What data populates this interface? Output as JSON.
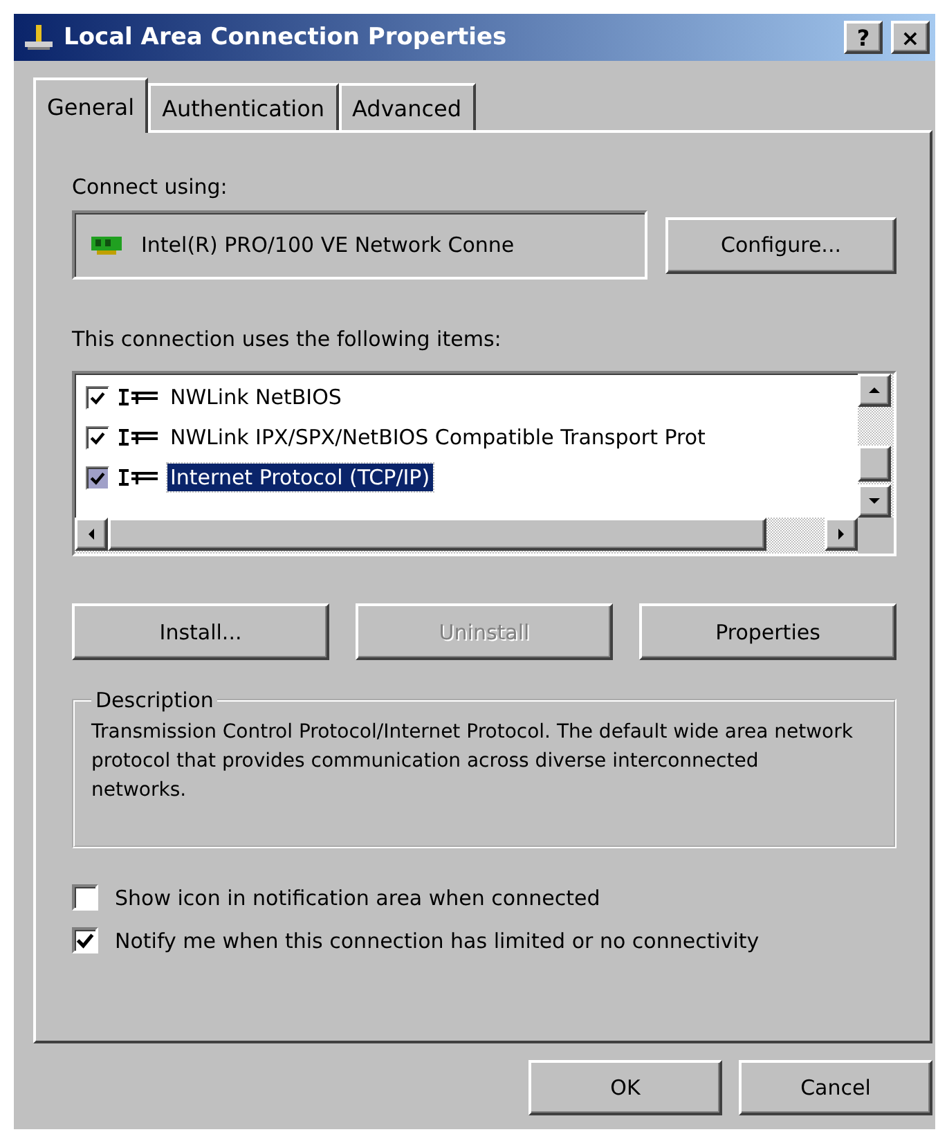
{
  "window": {
    "title": "Local Area Connection Properties",
    "title_buttons": [
      "?",
      "×"
    ]
  },
  "tabs": [
    {
      "label": "General",
      "selected": true
    },
    {
      "label": "Authentication",
      "selected": false
    },
    {
      "label": "Advanced",
      "selected": false
    }
  ],
  "connect_using": {
    "label": "Connect using:",
    "adapter": "Intel(R) PRO/100 VE Network Conne",
    "button": "Configure..."
  },
  "items_label": "This connection uses the following items:",
  "items": [
    {
      "label": "NWLink NetBIOS",
      "checked": true,
      "selected": false
    },
    {
      "label": "NWLink IPX/SPX/NetBIOS Compatible Transport Prot",
      "checked": true,
      "selected": false
    },
    {
      "label": "Internet Protocol (TCP/IP)",
      "checked": true,
      "selected": true
    }
  ],
  "item_buttons": [
    {
      "label": "Install...",
      "disabled": false
    },
    {
      "label": "Uninstall",
      "disabled": true
    },
    {
      "label": "Properties",
      "disabled": false
    }
  ],
  "description": {
    "title": "Description",
    "text": "Transmission Control Protocol/Internet Protocol. The default wide area network protocol that provides communication across diverse interconnected networks."
  },
  "options": [
    {
      "label": "Show icon in notification area when connected",
      "checked": false
    },
    {
      "label": "Notify me when this connection has limited or no connectivity",
      "checked": true
    }
  ],
  "footer_buttons": [
    "OK",
    "Cancel"
  ]
}
